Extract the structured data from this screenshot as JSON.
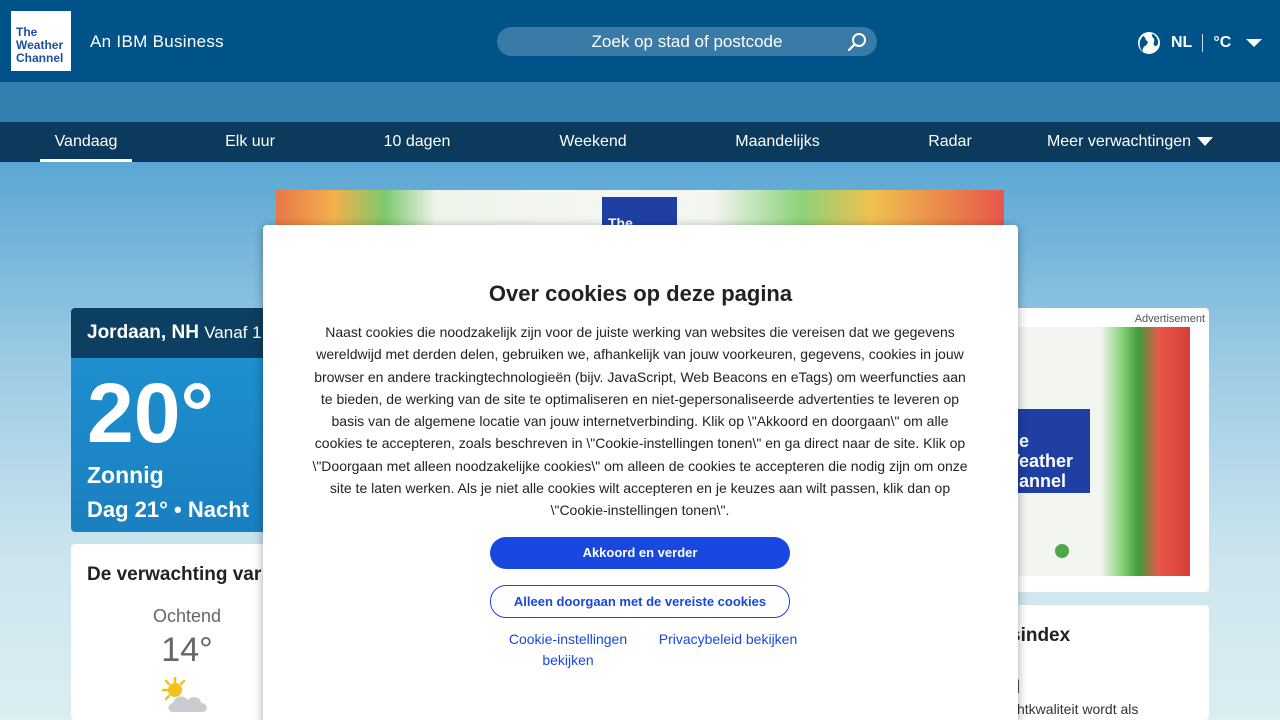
{
  "header": {
    "logo_lines": [
      "The",
      "Weather",
      "Channel"
    ],
    "tagline": "An IBM Business",
    "search_placeholder": "Zoek op stad of postcode",
    "language": "NL",
    "unit": "°C"
  },
  "nav": {
    "items": [
      {
        "label": "Vandaag"
      },
      {
        "label": "Elk uur"
      },
      {
        "label": "10 dagen"
      },
      {
        "label": "Weekend"
      },
      {
        "label": "Maandelijks"
      },
      {
        "label": "Radar"
      },
      {
        "label": "Meer verwachtingen"
      }
    ]
  },
  "ad_top": {
    "logo_text": "The"
  },
  "current": {
    "location": "Jordaan, NH",
    "since": "Vanaf 1",
    "temp": "20°",
    "phrase": "Zonnig",
    "day_night": "Dag 21° • Nacht"
  },
  "forecast": {
    "title": "De verwachting var",
    "period_label": "Ochtend",
    "period_temp": "14°"
  },
  "ad_right": {
    "label": "Advertisement",
    "logo_lines": [
      "he",
      "Veather",
      "hannel"
    ]
  },
  "air_quality": {
    "title": "sindex",
    "value": "d",
    "text": "chtkwaliteit wordt als"
  },
  "modal": {
    "title": "Over cookies op deze pagina",
    "body": "Naast cookies die noodzakelijk zijn voor de juiste werking van websites die vereisen dat we gegevens wereldwijd met derden delen, gebruiken we, afhankelijk van jouw voorkeuren, gegevens, cookies in jouw browser en andere trackingtechnologieën (bijv. JavaScript, Web Beacons en eTags) om weerfuncties aan te bieden, de werking van de site te optimaliseren en niet-gepersonaliseerde advertenties te leveren op basis van de algemene locatie van jouw internetverbinding. Klik op \\\"Akkoord en doorgaan\\\" om alle cookies te accepteren, zoals beschreven in \\\"Cookie-instellingen tonen\\\" en ga direct naar de site. Klik op \\\"Doorgaan met alleen noodzakelijke cookies\\\" om alleen de cookies te accepteren die nodig zijn om onze site te laten werken. Als je niet alle cookies wilt accepteren en je keuzes aan wilt passen, klik dan op \\\"Cookie-instellingen tonen\\\".",
    "accept_label": "Akkoord en verder",
    "required_label": "Alleen doorgaan met de vereiste cookies",
    "settings_link": "Cookie-instellingen bekijken",
    "privacy_link": "Privacybeleid bekijken"
  },
  "colors": {
    "header_bg": "#005389",
    "nav_bg": "#0b3a5d",
    "primary_button": "#1848e0"
  }
}
